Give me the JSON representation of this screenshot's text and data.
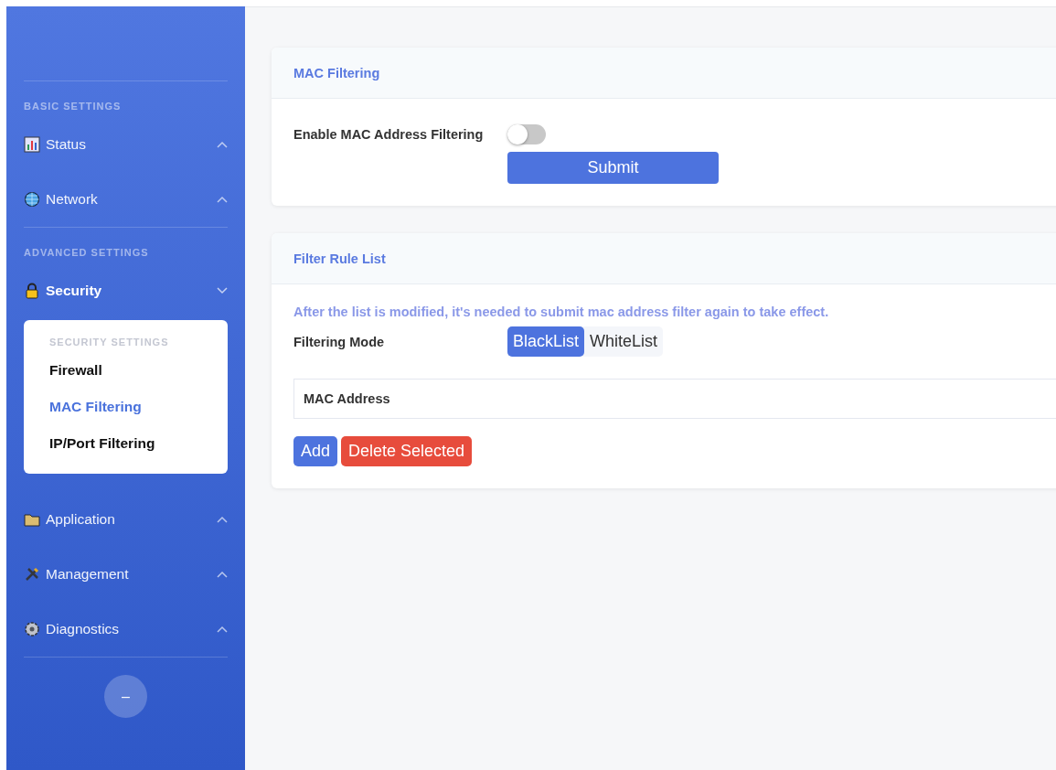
{
  "sidebar": {
    "sections": [
      {
        "title": "BASIC SETTINGS",
        "items": [
          {
            "label": "Status",
            "expanded": false
          },
          {
            "label": "Network",
            "expanded": false
          }
        ]
      },
      {
        "title": "ADVANCED SETTINGS",
        "items": [
          {
            "label": "Security",
            "expanded": true,
            "submenu_title": "SECURITY SETTINGS",
            "children": [
              {
                "label": "Firewall",
                "selected": false
              },
              {
                "label": "MAC Filtering",
                "selected": true
              },
              {
                "label": "IP/Port Filtering",
                "selected": false
              }
            ]
          },
          {
            "label": "Application",
            "expanded": false
          },
          {
            "label": "Management",
            "expanded": false
          },
          {
            "label": "Diagnostics",
            "expanded": false
          }
        ]
      }
    ],
    "collapse_button": "–"
  },
  "mac_card": {
    "title": "MAC Filtering",
    "toggle_label": "Enable MAC Address Filtering",
    "enabled": false,
    "submit": "Submit"
  },
  "rule_card": {
    "title": "Filter Rule List",
    "note": "After the list is modified, it's needed to submit mac address filter again to take effect.",
    "mode_label": "Filtering Mode",
    "modes": [
      {
        "label": "BlackList",
        "selected": true
      },
      {
        "label": "WhiteList",
        "selected": false
      }
    ],
    "table": {
      "columns": [
        "MAC Address"
      ]
    },
    "buttons": [
      {
        "label": "Add",
        "kind": "primary"
      },
      {
        "label": "Delete Selected",
        "kind": "danger"
      }
    ]
  }
}
